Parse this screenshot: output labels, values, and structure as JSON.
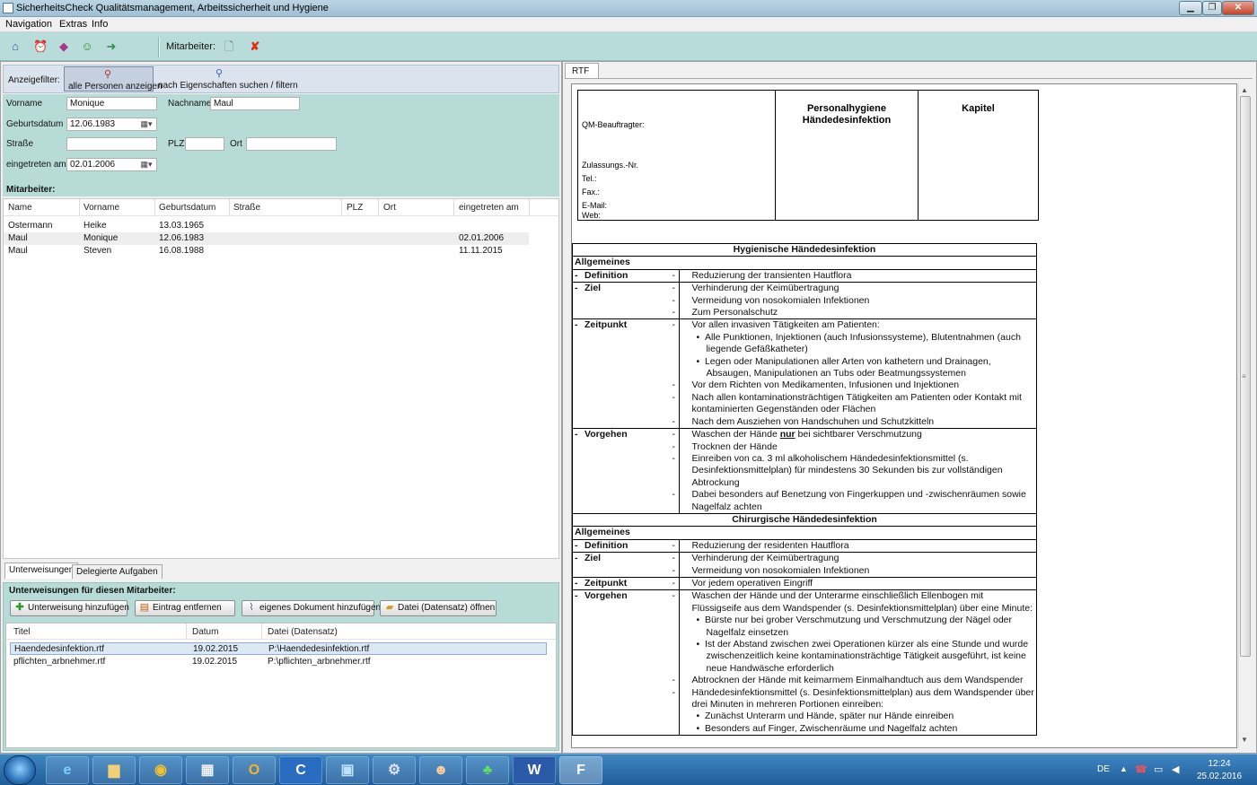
{
  "window": {
    "title": "SicherheitsCheck Qualitätsmanagement, Arbeitssicherheit und Hygiene"
  },
  "menu": [
    "Navigation",
    "Extras",
    "Info"
  ],
  "toolbar": {
    "employee_label": "Mitarbeiter:"
  },
  "filter": {
    "label": "Anzeigefilter:",
    "show_all": "alle Personen anzeigen",
    "search": "nach Eigenschaften suchen / filtern"
  },
  "form": {
    "firstname_label": "Vorname",
    "firstname": "Monique",
    "lastname_label": "Nachname",
    "lastname": "Maul",
    "birthdate_label": "Geburtsdatum",
    "birthdate": "12.06.1983",
    "street_label": "Straße",
    "street": "",
    "zip_label": "PLZ",
    "zip": "",
    "city_label": "Ort",
    "city": "",
    "joined_label": "eingetreten am",
    "joined": "02.01.2006",
    "employees_label": "Mitarbeiter:"
  },
  "employees": {
    "columns": [
      "Name",
      "Vorname",
      "Geburtsdatum",
      "Straße",
      "PLZ",
      "Ort",
      "eingetreten am"
    ],
    "rows": [
      [
        "Ostermann",
        "Heike",
        "13.03.1965",
        "",
        "",
        "",
        ""
      ],
      [
        "Maul",
        "Monique",
        "12.06.1983",
        "",
        "",
        "",
        "02.01.2006"
      ],
      [
        "Maul",
        "Steven",
        "16.08.1988",
        "",
        "",
        "",
        "11.11.2015"
      ]
    ]
  },
  "bottom_tabs": [
    "Unterweisungen",
    "Delegierte Aufgaben"
  ],
  "trainings": {
    "title": "Unterweisungen für diesen Mitarbeiter:",
    "buttons": [
      "Unterweisung hinzufügen",
      "Eintrag entfernen",
      "eigenes Dokument hinzufügen",
      "Datei (Datensatz) öffnen"
    ],
    "columns": [
      "Titel",
      "Datum",
      "Datei (Datensatz)"
    ],
    "rows": [
      [
        "Haendedesinfektion.rtf",
        "19.02.2015",
        "P:\\Haendedesinfektion.rtf"
      ],
      [
        "pflichten_arbnehmer.rtf",
        "19.02.2015",
        "P:\\pflichten_arbnehmer.rtf"
      ]
    ]
  },
  "rtf_tab": "RTF",
  "doc_header": {
    "fields": [
      "QM-Beauftragter:",
      "Zulassungs.-Nr.",
      "Tel.:",
      "Fax.:",
      "E-Mail:",
      "Web:"
    ],
    "title_line1": "Personalhygiene",
    "title_line2": "Händedesinfektion",
    "chapter": "Kapitel"
  },
  "doc": {
    "section1": "Hygienische Händedesinfektion",
    "general": "Allgemeines",
    "definition_key": "Definition",
    "definition1": "Reduzierung der transienten Hautflora",
    "ziel_key": "Ziel",
    "ziel1": [
      "Verhinderung der Keimübertragung",
      "Vermeidung von nosokomialen Infektionen",
      "Zum Personalschutz"
    ],
    "zeitpunkt_key": "Zeitpunkt",
    "zp_intro": "Vor allen invasiven Tätigkeiten am Patienten:",
    "zp_b1": "Alle Punktionen, Injektionen (auch Infusionssysteme), Blutentnahmen (auch liegende Gefäßkatheter)",
    "zp_b2": "Legen oder Manipulationen aller Arten von kathetern und Drainagen, Absaugen, Manipulationen an Tubs oder Beatmungssystemen",
    "zp_l2": "Vor dem Richten von Medikamenten, Infusionen und Injektionen",
    "zp_l3": "Nach allen kontaminationsträchtigen Tätigkeiten am Patienten oder Kontakt mit kontaminierten Gegenständen oder Flächen",
    "zp_l4": "Nach dem Ausziehen von Handschuhen und Schutzkitteln",
    "vorgehen_key": "Vorgehen",
    "vg_l1_a": "Waschen der Hände ",
    "vg_l1_b": "nur",
    "vg_l1_c": " bei sichtbarer Verschmutzung",
    "vg_l2": "Trocknen der Hände",
    "vg_l3": "Einreiben von ca. 3 ml alkoholischem Händedesinfektionsmittel  (s. Desinfektionsmittelplan) für mindestens 30 Sekunden bis zur vollständigen Abtrockung",
    "vg_l4": "Dabei besonders auf Benetzung von Fingerkuppen und -zwischenräumen sowie Nagelfalz achten",
    "section2": "Chirurgische Händedesinfektion",
    "definition2": "Reduzierung der residenten Hautflora",
    "ziel2": [
      "Verhinderung der Keimübertragung",
      "Vermeidung von nosokomialen Infektionen"
    ],
    "zeitpunkt2": "Vor jedem operativen Eingriff",
    "vg2_l1": "Waschen der Hände und der Unterarme einschließlich Ellenbogen mit Flüssigseife aus dem Wandspender (s. Desinfektionsmittelplan) über eine Minute:",
    "vg2_b1": "Bürste nur bei grober Verschmutzung und Verschmutzung der Nägel oder Nagelfalz einsetzen",
    "vg2_b2": "Ist der Abstand zwischen zwei Operationen kürzer als eine Stunde und wurde zwischenzeitlich keine kontaminationsträchtige Tätigkeit ausgeführt, ist keine neue Handwäsche erforderlich",
    "vg2_l2": "Abtrocknen der Hände mit keimarmem Einmalhandtuch aus dem Wandspender",
    "vg2_l3": "Händedesinfektionsmittel (s. Desinfektionsmittelplan) aus dem Wandspender über drei Minuten in mehreren Portionen einreiben:",
    "vg2_b3": "Zunächst Unterarm und Hände, später nur Hände einreiben",
    "vg2_b4": "Besonders auf Finger, Zwischenräume und Nagelfalz achten"
  },
  "taskbar": {
    "lang": "DE",
    "time": "12:24",
    "date": "25.02.2016"
  }
}
